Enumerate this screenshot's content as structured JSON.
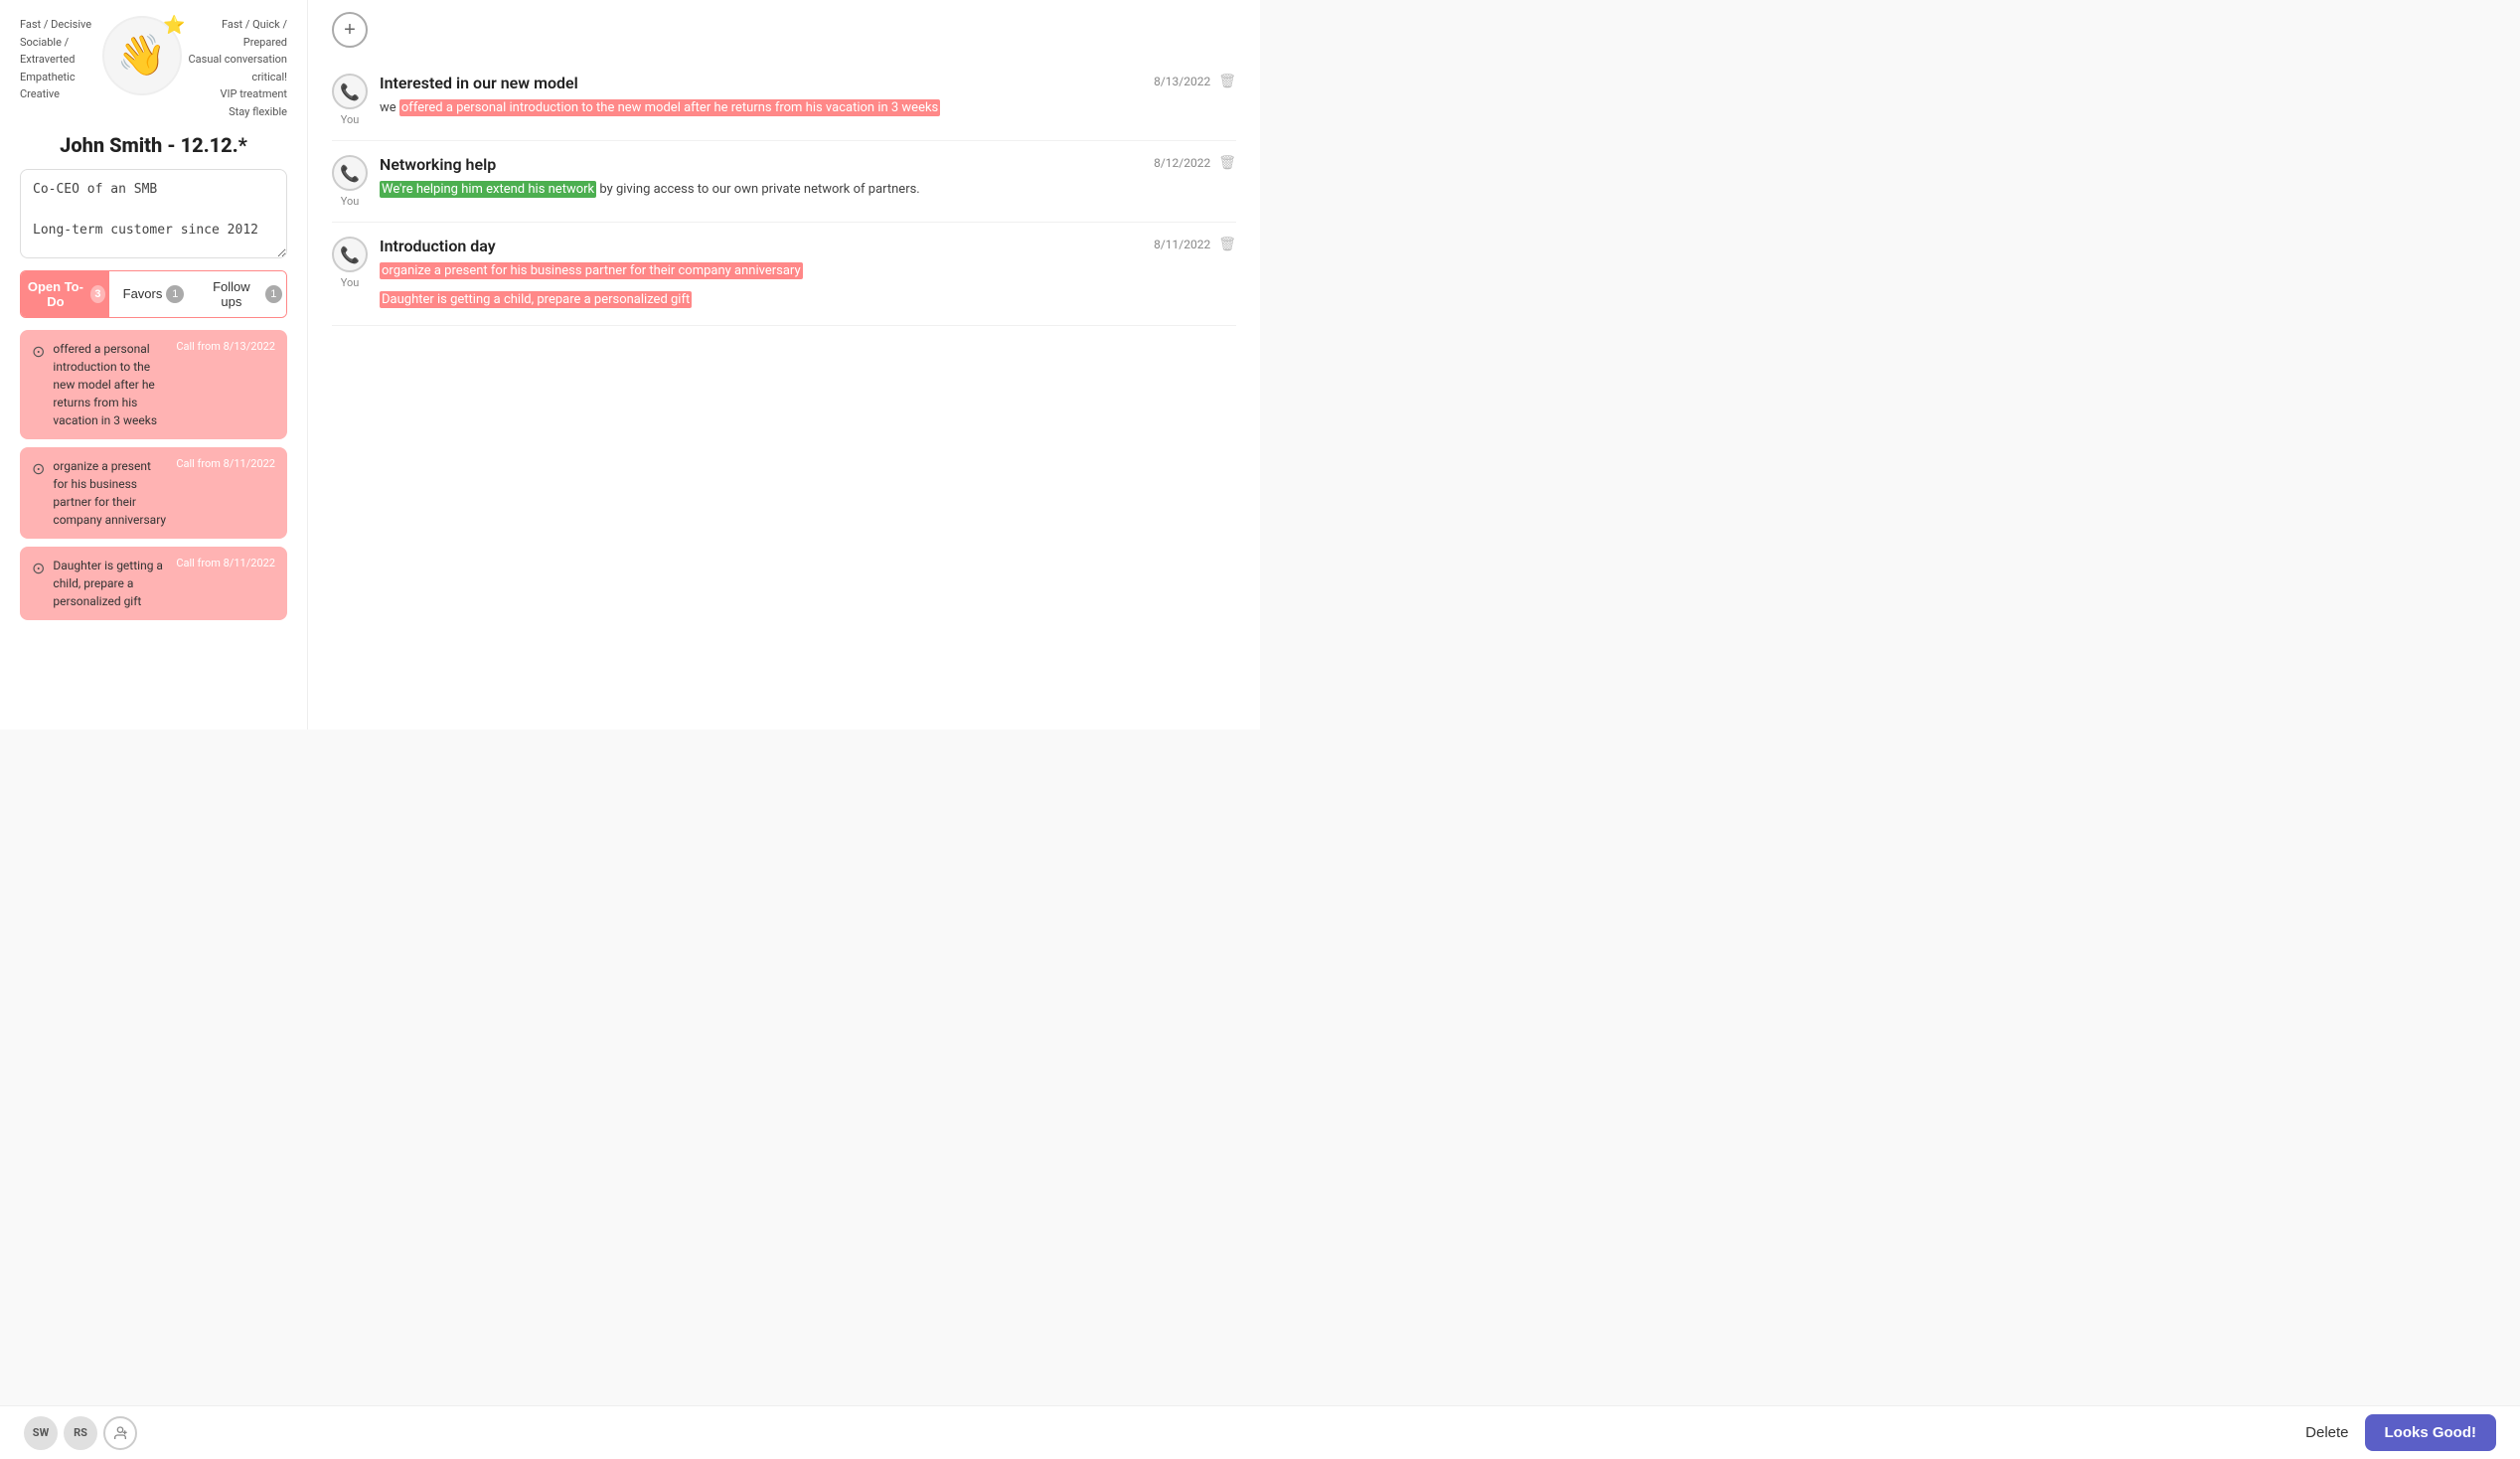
{
  "profile": {
    "name": "John Smith - 12.12.*",
    "avatar_emoji": "👋",
    "star": "⭐",
    "notes": "Co-CEO of an SMB\n\nLong-term customer since 2012"
  },
  "traits": {
    "left": [
      "Fast / Decisive",
      "Sociable / Extraverted",
      "Empathetic",
      "Creative"
    ],
    "right": [
      "Fast / Quick / Prepared",
      "Casual conversation critical!",
      "VIP treatment",
      "Stay flexible"
    ]
  },
  "tabs": [
    {
      "label": "Open To-Do",
      "badge": "3",
      "active": true
    },
    {
      "label": "Favors",
      "badge": "1",
      "active": false
    },
    {
      "label": "Follow ups",
      "badge": "1",
      "active": false
    }
  ],
  "todos": [
    {
      "text": "offered a personal introduction to the new model after he returns from his vacation in 3 weeks",
      "date": "Call from\n8/13/2022"
    },
    {
      "text": "organize a present for his business partner for their company anniversary",
      "date": "Call from\n8/11/2022"
    },
    {
      "text": "Daughter is getting a child, prepare a personalized gift",
      "date": "Call from\n8/11/2022"
    }
  ],
  "calls": [
    {
      "title": "Interested in our new model",
      "date": "8/13/2022",
      "you_label": "You",
      "text_before": "we ",
      "highlight": "offered a personal introduction to the new model after he returns from his vacation in 3 weeks",
      "highlight_type": "red",
      "text_after": ""
    },
    {
      "title": "Networking help",
      "date": "8/12/2022",
      "you_label": "You",
      "text_before": "",
      "highlight": "We're helping him extend his network",
      "highlight_type": "green",
      "text_after": " by giving access to our own private network of partners."
    },
    {
      "title": "Introduction day",
      "date": "8/11/2022",
      "you_label": "You",
      "text_before": "",
      "highlight": "organize a present for his business partner for their company anniversary",
      "highlight_type": "red",
      "text_after": "",
      "extra_highlight": "Daughter is getting a child, prepare a personalized gift",
      "extra_highlight_type": "red"
    }
  ],
  "bottom": {
    "users": [
      "SW",
      "RS"
    ],
    "delete_label": "Delete",
    "looks_good_label": "Looks Good!"
  }
}
